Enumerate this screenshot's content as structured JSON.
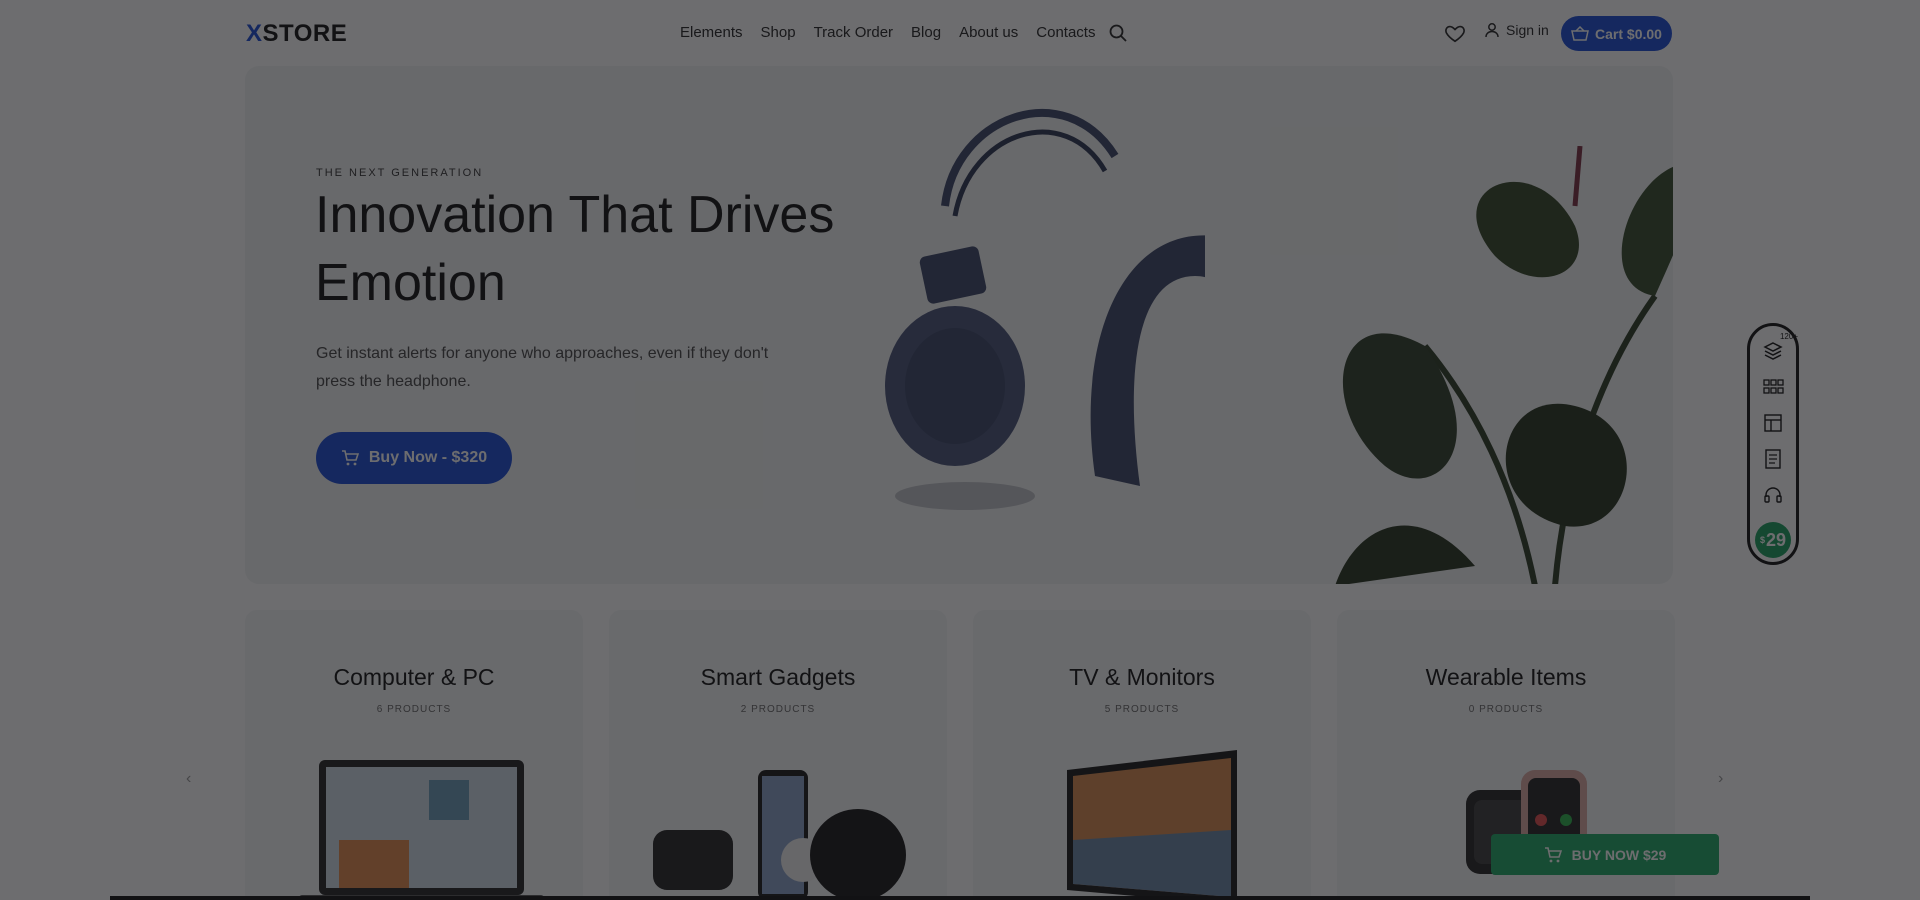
{
  "brand": {
    "logo_mark": "X",
    "logo_text": "STORE"
  },
  "nav": {
    "items": [
      "Elements",
      "Shop",
      "Track Order",
      "Blog",
      "About us",
      "Contacts"
    ],
    "signin_label": "Sign in",
    "cart_label": "Cart $0.00"
  },
  "hero": {
    "eyebrow": "THE NEXT GENERATION",
    "title": "Innovation That Drives Emotion",
    "subtitle": "Get instant alerts for anyone who approaches, even if they don't press the headphone.",
    "button_label": "Buy Now - $320"
  },
  "toolbar": {
    "badge": "120+",
    "price": "29",
    "price_currency": "$"
  },
  "categories": [
    {
      "title": "Computer & PC",
      "count": "6 PRODUCTS"
    },
    {
      "title": "Smart Gadgets",
      "count": "2 PRODUCTS"
    },
    {
      "title": "TV & Monitors",
      "count": "5 PRODUCTS"
    },
    {
      "title": "Wearable Items",
      "count": "0 PRODUCTS"
    }
  ],
  "sticky_buy": {
    "label": "BUY NOW $29"
  },
  "colors": {
    "accent": "#1a4bd6",
    "green": "#1fa865",
    "overlay": "rgba(20,20,22,0.62)"
  }
}
